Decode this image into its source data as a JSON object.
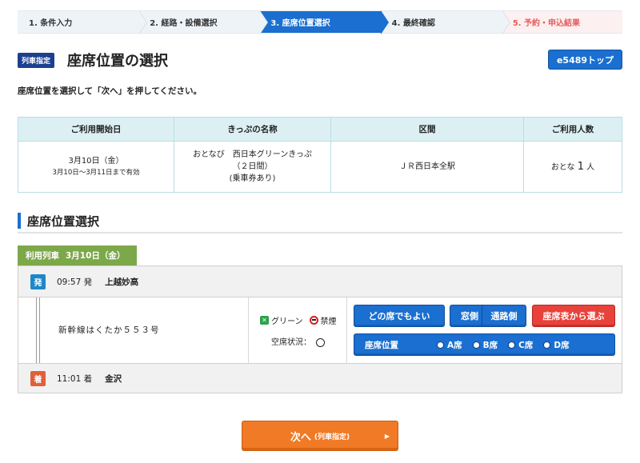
{
  "steps": [
    {
      "label": "1. 条件入力"
    },
    {
      "label": "2. 経路・設備選択"
    },
    {
      "label": "3. 座席位置選択"
    },
    {
      "label": "4. 最終確認"
    },
    {
      "label": "5. 予約・申込結果"
    }
  ],
  "header": {
    "badge": "列車指定",
    "title": "座席位置の選択",
    "top_button": "e5489トップ",
    "instruction": "座席位置を選択して「次へ」を押してください。"
  },
  "ticket_table": {
    "headers": [
      "ご利用開始日",
      "きっぷの名称",
      "区間",
      "ご利用人数"
    ],
    "start_date": "3月10日（金）",
    "valid_period": "3月10日～3月11日まで有効",
    "ticket_name_line1": "おとなび　西日本グリーンきっぷ",
    "ticket_name_line2": "（２日間）",
    "ticket_name_line3": "(乗車券あり)",
    "section": "ＪＲ西日本全駅",
    "passengers_label": "おとな",
    "passengers_count": "1",
    "passengers_unit": "人"
  },
  "section": {
    "title": "座席位置選択"
  },
  "train": {
    "tab_label": "利用列車",
    "tab_date": "3月10日（金）",
    "dep_tag": "発",
    "dep_time": "09:57 発",
    "dep_station": "上越妙高",
    "name": "新幹線はくたか５５３号",
    "legend_green": "グリーン",
    "legend_nosmoking": "禁煙",
    "vacancy_label": "空席状況：",
    "arr_tag": "着",
    "arr_time": "11:01 着",
    "arr_station": "金沢"
  },
  "seat_buttons": {
    "any": "どの席でもよい",
    "window": "窓側",
    "aisle": "通路側",
    "from_map": "座席表から選ぶ"
  },
  "seat_position": {
    "label": "座席位置",
    "options": [
      "A席",
      "B席",
      "C席",
      "D席"
    ]
  },
  "next_button": {
    "label": "次へ",
    "sub": "(列車指定)"
  },
  "colors": {
    "primary_blue": "#1a6fd0",
    "green_tab": "#7da84a",
    "orange_next": "#f07a25",
    "red_button": "#e8423a"
  }
}
